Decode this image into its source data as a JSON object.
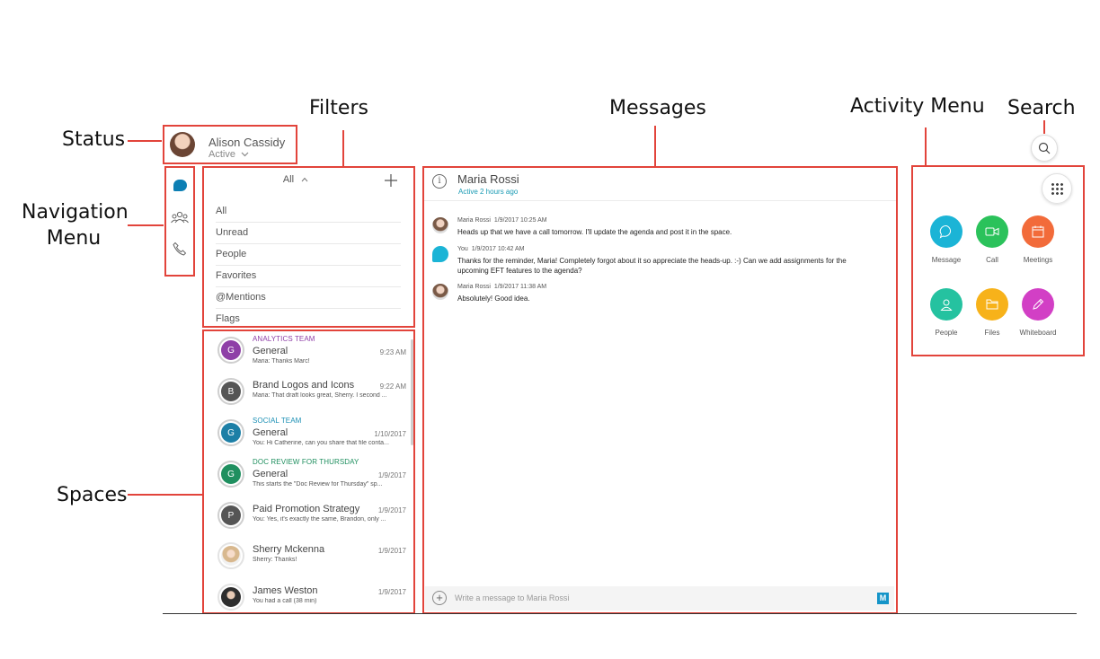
{
  "callouts": {
    "status": "Status",
    "navigation_line1": "Navigation",
    "navigation_line2": "Menu",
    "filters": "Filters",
    "messages": "Messages",
    "activity_menu": "Activity Menu",
    "search": "Search",
    "spaces": "Spaces"
  },
  "colors": {
    "callout_red": "#e2443b",
    "accent_teal": "#1a9bb4"
  },
  "user": {
    "name": "Alison Cassidy",
    "status": "Active"
  },
  "nav": {
    "items": [
      {
        "icon": "chat-bubble-icon",
        "active": true
      },
      {
        "icon": "people-icon",
        "active": false
      },
      {
        "icon": "phone-icon",
        "active": false
      }
    ]
  },
  "filters": {
    "header": "All",
    "items": [
      "All",
      "Unread",
      "People",
      "Favorites",
      "@Mentions",
      "Flags"
    ]
  },
  "spaces": [
    {
      "team": "ANALYTICS TEAM",
      "team_color": "#8e3fa7",
      "name": "General",
      "time": "9:23 AM",
      "preview": "Maria: Thanks Marc!",
      "initial": "G",
      "avatar_color": "#8e3fa7"
    },
    {
      "team": "",
      "team_color": "",
      "name": "Brand Logos and Icons",
      "time": "9:22 AM",
      "preview": "Maria: That draft looks great, Sherry. I second ...",
      "initial": "B",
      "avatar_color": "#555555"
    },
    {
      "team": "SOCIAL TEAM",
      "team_color": "#1a8fb4",
      "name": "General",
      "time": "1/10/2017",
      "preview": "You: Hi Catherine, can you share that file conta...",
      "initial": "G",
      "avatar_color": "#1d7fa6"
    },
    {
      "team": "DOC REVIEW FOR THURSDAY",
      "team_color": "#1f8f5f",
      "name": "General",
      "time": "1/9/2017",
      "preview": "This starts the \"Doc Review for Thursday\" sp...",
      "initial": "G",
      "avatar_color": "#1f8f5f"
    },
    {
      "team": "",
      "team_color": "",
      "name": "Paid Promotion Strategy",
      "time": "1/9/2017",
      "preview": "You: Yes, it's exactly the same, Brandon, only ...",
      "initial": "P",
      "avatar_color": "#555555"
    },
    {
      "team": "",
      "team_color": "",
      "name": "Sherry Mckenna",
      "time": "1/9/2017",
      "preview": "Sherry: Thanks!",
      "initial": "",
      "avatar_color": "#d8c3a9"
    },
    {
      "team": "",
      "team_color": "",
      "name": "James Weston",
      "time": "1/9/2017",
      "preview": "You had a call (38 min)",
      "initial": "",
      "avatar_color": "#3a3a3a"
    }
  ],
  "conversation": {
    "title": "Maria Rossi",
    "subtitle": "Active 2 hours ago",
    "messages": [
      {
        "sender": "Maria Rossi",
        "timestamp": "1/9/2017 10:25 AM",
        "text": "Heads up that we have a call tomorrow. I'll update the agenda and post it in the space."
      },
      {
        "sender": "You",
        "timestamp": "1/9/2017 10:42 AM",
        "text": "Thanks for the reminder, Maria! Completely forgot about it so appreciate the heads-up. :-) Can we add assignments for the upcoming EFT features to the agenda?"
      },
      {
        "sender": "Maria Rossi",
        "timestamp": "1/9/2017 11:38 AM",
        "text": "Absolutely! Good idea."
      }
    ],
    "composer_placeholder": "Write a message to Maria Rossi",
    "composer_badge": "M"
  },
  "activity": {
    "items": [
      {
        "label": "Message",
        "color": "#1bb4d6",
        "icon": "message-icon"
      },
      {
        "label": "Call",
        "color": "#2bc25b",
        "icon": "video-icon"
      },
      {
        "label": "Meetings",
        "color": "#f26b3a",
        "icon": "calendar-icon"
      },
      {
        "label": "People",
        "color": "#25c2a0",
        "icon": "person-icon"
      },
      {
        "label": "Files",
        "color": "#f7b21a",
        "icon": "folder-icon"
      },
      {
        "label": "Whiteboard",
        "color": "#d23fc5",
        "icon": "pencil-icon"
      }
    ]
  }
}
